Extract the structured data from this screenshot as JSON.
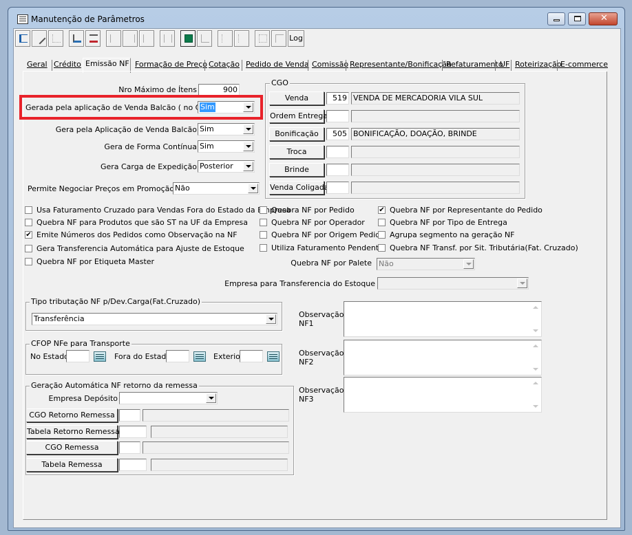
{
  "window": {
    "title": "Manutenção de Parâmetros"
  },
  "toolbar": {
    "log_label": "Log"
  },
  "tabs": [
    "Geral",
    "Crédito",
    "Emissão NF",
    "Formação de Preço",
    "Cotação",
    "Pedido de Venda",
    "Comissão",
    "Representante/Bonificação",
    "Refaturamento",
    "UF",
    "Roteirização",
    "E-commerce"
  ],
  "form": {
    "nro_maximo_itens": {
      "label": "Nro Máximo de Ítens",
      "value": "900"
    },
    "gerada_venda_balcao": {
      "label": "Gerada pela aplicação de Venda Balcão ( no Caixa )",
      "value": "Sim"
    },
    "gera_aplicacao_venda_balcao": {
      "label": "Gera pela Aplicação de Venda Balcão",
      "value": "Sim"
    },
    "gera_forma_continua": {
      "label": "Gera de Forma Contínua",
      "value": "Sim"
    },
    "gera_carga_expedicao": {
      "label": "Gera Carga de Expedição",
      "value": "Posterior"
    },
    "permite_negociar_precos": {
      "label": "Permite Negociar Preços em Promoção",
      "value": "Não"
    }
  },
  "cgo": {
    "title": "CGO",
    "rows": [
      {
        "button": "Venda",
        "code": "519",
        "desc": "VENDA DE MERCADORIA VILA SUL"
      },
      {
        "button": "Ordem Entrega",
        "code": "",
        "desc": ""
      },
      {
        "button": "Bonificação",
        "code": "505",
        "desc": "BONIFICAÇÃO, DOAÇÃO, BRINDE"
      },
      {
        "button": "Troca",
        "code": "",
        "desc": ""
      },
      {
        "button": "Brinde",
        "code": "",
        "desc": ""
      },
      {
        "button": "Venda Coligada",
        "code": "",
        "desc": ""
      }
    ]
  },
  "checks": {
    "col1": [
      {
        "label": "Usa Faturamento Cruzado para Vendas Fora do Estado da Empresa",
        "checked": false
      },
      {
        "label": "Quebra NF para Produtos que são ST na UF da Empresa",
        "checked": false
      },
      {
        "label": "Emite Números dos Pedidos como Observação na NF",
        "checked": true
      },
      {
        "label": "Gera Transferencia Automática para Ajuste de Estoque",
        "checked": false
      },
      {
        "label": "Quebra NF por Etiqueta Master",
        "checked": false
      }
    ],
    "col2": [
      {
        "label": "Quebra NF por Pedido",
        "checked": false
      },
      {
        "label": "Quebra NF por Operador",
        "checked": false
      },
      {
        "label": "Quebra NF por Origem Pedido",
        "checked": false
      },
      {
        "label": "Utiliza Faturamento Pendente",
        "checked": false
      }
    ],
    "col3": [
      {
        "label": "Quebra NF por Representante do Pedido",
        "checked": true
      },
      {
        "label": "Quebra NF por Tipo de Entrega",
        "checked": false
      },
      {
        "label": "Agrupa segmento na geração NF",
        "checked": false
      },
      {
        "label": "Quebra NF Transf. por Sit. Tributária(Fat. Cruzado)",
        "checked": false
      }
    ]
  },
  "quebra_palete": {
    "label": "Quebra NF por Palete",
    "value": "Não"
  },
  "empresa_transferencia": {
    "label": "Empresa para Transferencia do Estoque",
    "value": ""
  },
  "tipo_tributacao": {
    "title": "Tipo tributação NF p/Dev.Carga(Fat.Cruzado)",
    "value": "Transferência"
  },
  "cfop": {
    "title": "CFOP NFe para Transporte",
    "no_estado": "No Estado",
    "fora_estado": "Fora do Estado",
    "exterior": "Exterior"
  },
  "geracao": {
    "title": "Geração Automática NF retorno da remessa",
    "empresa_deposito": "Empresa Depósito",
    "buttons": [
      "CGO Retorno Remessa",
      "Tabela Retorno Remessa",
      "CGO Remessa",
      "Tabela Remessa"
    ]
  },
  "observacoes": [
    {
      "l1": "Observação",
      "l2": "NF1"
    },
    {
      "l1": "Observação",
      "l2": "NF2"
    },
    {
      "l1": "Observação",
      "l2": "NF3"
    }
  ]
}
